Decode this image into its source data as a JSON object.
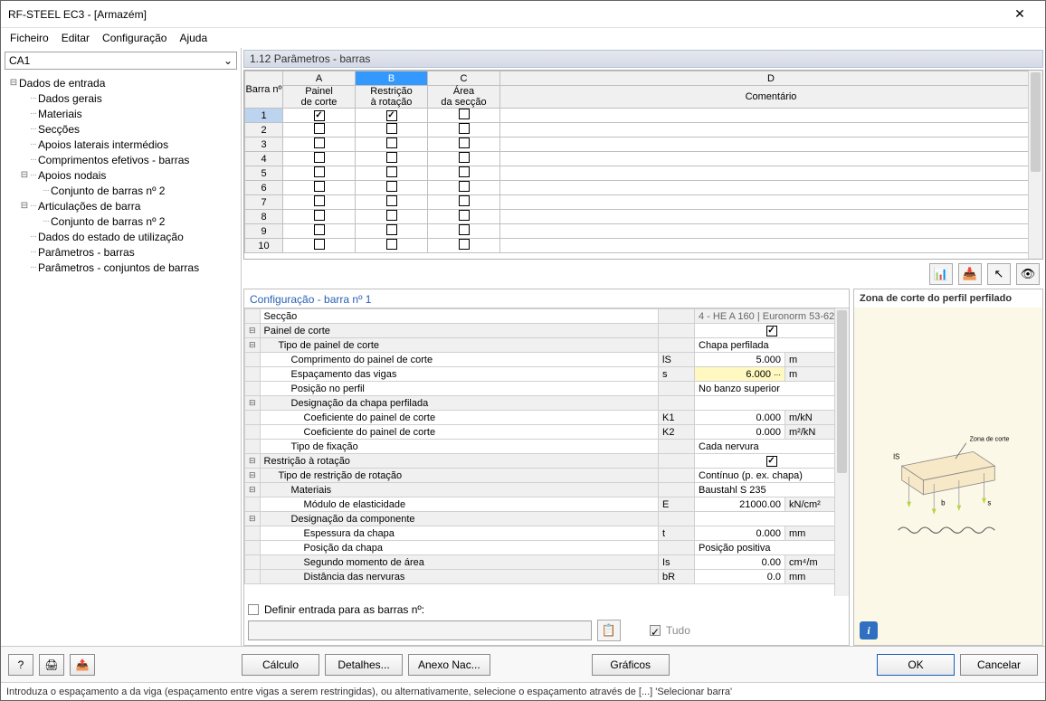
{
  "window": {
    "title": "RF-STEEL EC3 - [Armazém]"
  },
  "menu": {
    "items": [
      "Ficheiro",
      "Editar",
      "Configuração",
      "Ajuda"
    ]
  },
  "case_combo": "CA1",
  "tree": {
    "root": "Dados de entrada",
    "items": [
      {
        "label": "Dados gerais",
        "lvl": 1
      },
      {
        "label": "Materiais",
        "lvl": 1
      },
      {
        "label": "Secções",
        "lvl": 1
      },
      {
        "label": "Apoios laterais intermédios",
        "lvl": 1
      },
      {
        "label": "Comprimentos efetivos - barras",
        "lvl": 1
      },
      {
        "label": "Apoios nodais",
        "lvl": 1,
        "exp": "⊟"
      },
      {
        "label": "Conjunto de barras nº 2",
        "lvl": 2
      },
      {
        "label": "Articulações de barra",
        "lvl": 1,
        "exp": "⊟"
      },
      {
        "label": "Conjunto de barras nº 2",
        "lvl": 2
      },
      {
        "label": "Dados do estado de utilização",
        "lvl": 1
      },
      {
        "label": "Parâmetros - barras",
        "lvl": 1
      },
      {
        "label": "Parâmetros - conjuntos de barras",
        "lvl": 1
      }
    ]
  },
  "section_title": "1.12 Parâmetros - barras",
  "grid": {
    "col_letters": [
      "A",
      "B",
      "C",
      "D"
    ],
    "row_header": "Barra nº",
    "headers": {
      "A": "Painel de corte",
      "B": "Restrição à rotação",
      "C": "Área da secção",
      "D": "Comentário"
    },
    "rows": [
      {
        "n": "1",
        "a": true,
        "b": true,
        "c": false
      },
      {
        "n": "2",
        "a": false,
        "b": false,
        "c": false
      },
      {
        "n": "3",
        "a": false,
        "b": false,
        "c": false
      },
      {
        "n": "4",
        "a": false,
        "b": false,
        "c": false
      },
      {
        "n": "5",
        "a": false,
        "b": false,
        "c": false
      },
      {
        "n": "6",
        "a": false,
        "b": false,
        "c": false
      },
      {
        "n": "7",
        "a": false,
        "b": false,
        "c": false
      },
      {
        "n": "8",
        "a": false,
        "b": false,
        "c": false
      },
      {
        "n": "9",
        "a": false,
        "b": false,
        "c": false
      },
      {
        "n": "10",
        "a": false,
        "b": false,
        "c": false
      }
    ],
    "toolbar_icons": [
      "excel-export-icon",
      "excel-import-icon",
      "pick-icon",
      "eye-icon"
    ]
  },
  "props": {
    "title": "Configuração - barra nº 1",
    "rows": [
      {
        "label": "Secção",
        "sym": "",
        "val": "4 - HE A 160 | Euronorm 53-62",
        "unit": "",
        "exp": "",
        "lvl": 0,
        "type": "text",
        "ro": true
      },
      {
        "label": "Painel de corte",
        "sym": "",
        "val": "checkbox_on",
        "unit": "",
        "exp": "⊟",
        "lvl": 0,
        "type": "check"
      },
      {
        "label": "Tipo de painel de corte",
        "sym": "",
        "val": "Chapa perfilada",
        "unit": "",
        "exp": "⊟",
        "lvl": 1,
        "type": "text"
      },
      {
        "label": "Comprimento do painel de corte",
        "sym": "lS",
        "val": "5.000",
        "unit": "m",
        "lvl": 2,
        "type": "num"
      },
      {
        "label": "Espaçamento das vigas",
        "sym": "s",
        "val": "6.000",
        "unit": "m",
        "lvl": 2,
        "type": "num",
        "hl": true,
        "spin": true
      },
      {
        "label": "Posição no perfil",
        "sym": "",
        "val": "No banzo superior",
        "unit": "",
        "lvl": 2,
        "type": "text"
      },
      {
        "label": "Designação da chapa perfilada",
        "sym": "",
        "val": "",
        "unit": "",
        "exp": "⊟",
        "lvl": 2,
        "type": "text"
      },
      {
        "label": "Coeficiente do painel de corte",
        "sym": "K1",
        "val": "0.000",
        "unit": "m/kN",
        "lvl": 3,
        "type": "num"
      },
      {
        "label": "Coeficiente do painel de corte",
        "sym": "K2",
        "val": "0.000",
        "unit": "m²/kN",
        "lvl": 3,
        "type": "num"
      },
      {
        "label": "Tipo de fixação",
        "sym": "",
        "val": "Cada nervura",
        "unit": "",
        "lvl": 2,
        "type": "text"
      },
      {
        "label": "Restrição à rotação",
        "sym": "",
        "val": "checkbox_on",
        "unit": "",
        "exp": "⊟",
        "lvl": 0,
        "type": "check"
      },
      {
        "label": "Tipo de restrição de rotação",
        "sym": "",
        "val": "Contínuo (p. ex. chapa)",
        "unit": "",
        "exp": "⊟",
        "lvl": 1,
        "type": "text"
      },
      {
        "label": "Materiais",
        "sym": "",
        "val": "Baustahl S 235",
        "unit": "",
        "exp": "⊟",
        "lvl": 2,
        "type": "text"
      },
      {
        "label": "Módulo de elasticidade",
        "sym": "E",
        "val": "21000.00",
        "unit": "kN/cm²",
        "lvl": 3,
        "type": "num"
      },
      {
        "label": "Designação da componente",
        "sym": "",
        "val": "",
        "unit": "",
        "exp": "⊟",
        "lvl": 2,
        "type": "text"
      },
      {
        "label": "Espessura da chapa",
        "sym": "t",
        "val": "0.000",
        "unit": "mm",
        "lvl": 3,
        "type": "num"
      },
      {
        "label": "Posição da chapa",
        "sym": "",
        "val": "Posição positiva",
        "unit": "",
        "lvl": 3,
        "type": "text"
      },
      {
        "label": "Segundo momento de área",
        "sym": "Is",
        "val": "0.00",
        "unit": "cm⁴/m",
        "lvl": 3,
        "type": "num",
        "gray": true
      },
      {
        "label": "Distância das nervuras",
        "sym": "bR",
        "val": "0.0",
        "unit": "mm",
        "lvl": 3,
        "type": "num",
        "gray": true
      }
    ],
    "define_label": "Definir entrada para as barras nº:",
    "tudo_label": "Tudo"
  },
  "preview": {
    "title": "Zona de corte do perfil perfilado",
    "labels": {
      "zone": "Zona de corte",
      "ls": "lS",
      "b": "b",
      "s": "s"
    }
  },
  "footer": {
    "calc": "Cálculo",
    "details": "Detalhes...",
    "annex": "Anexo Nac...",
    "graphics": "Gráficos",
    "ok": "OK",
    "cancel": "Cancelar"
  },
  "status": "Introduza o espaçamento a da viga (espaçamento entre vigas a serem restringidas), ou alternativamente, selecione o espaçamento através de [...] 'Selecionar barra'"
}
